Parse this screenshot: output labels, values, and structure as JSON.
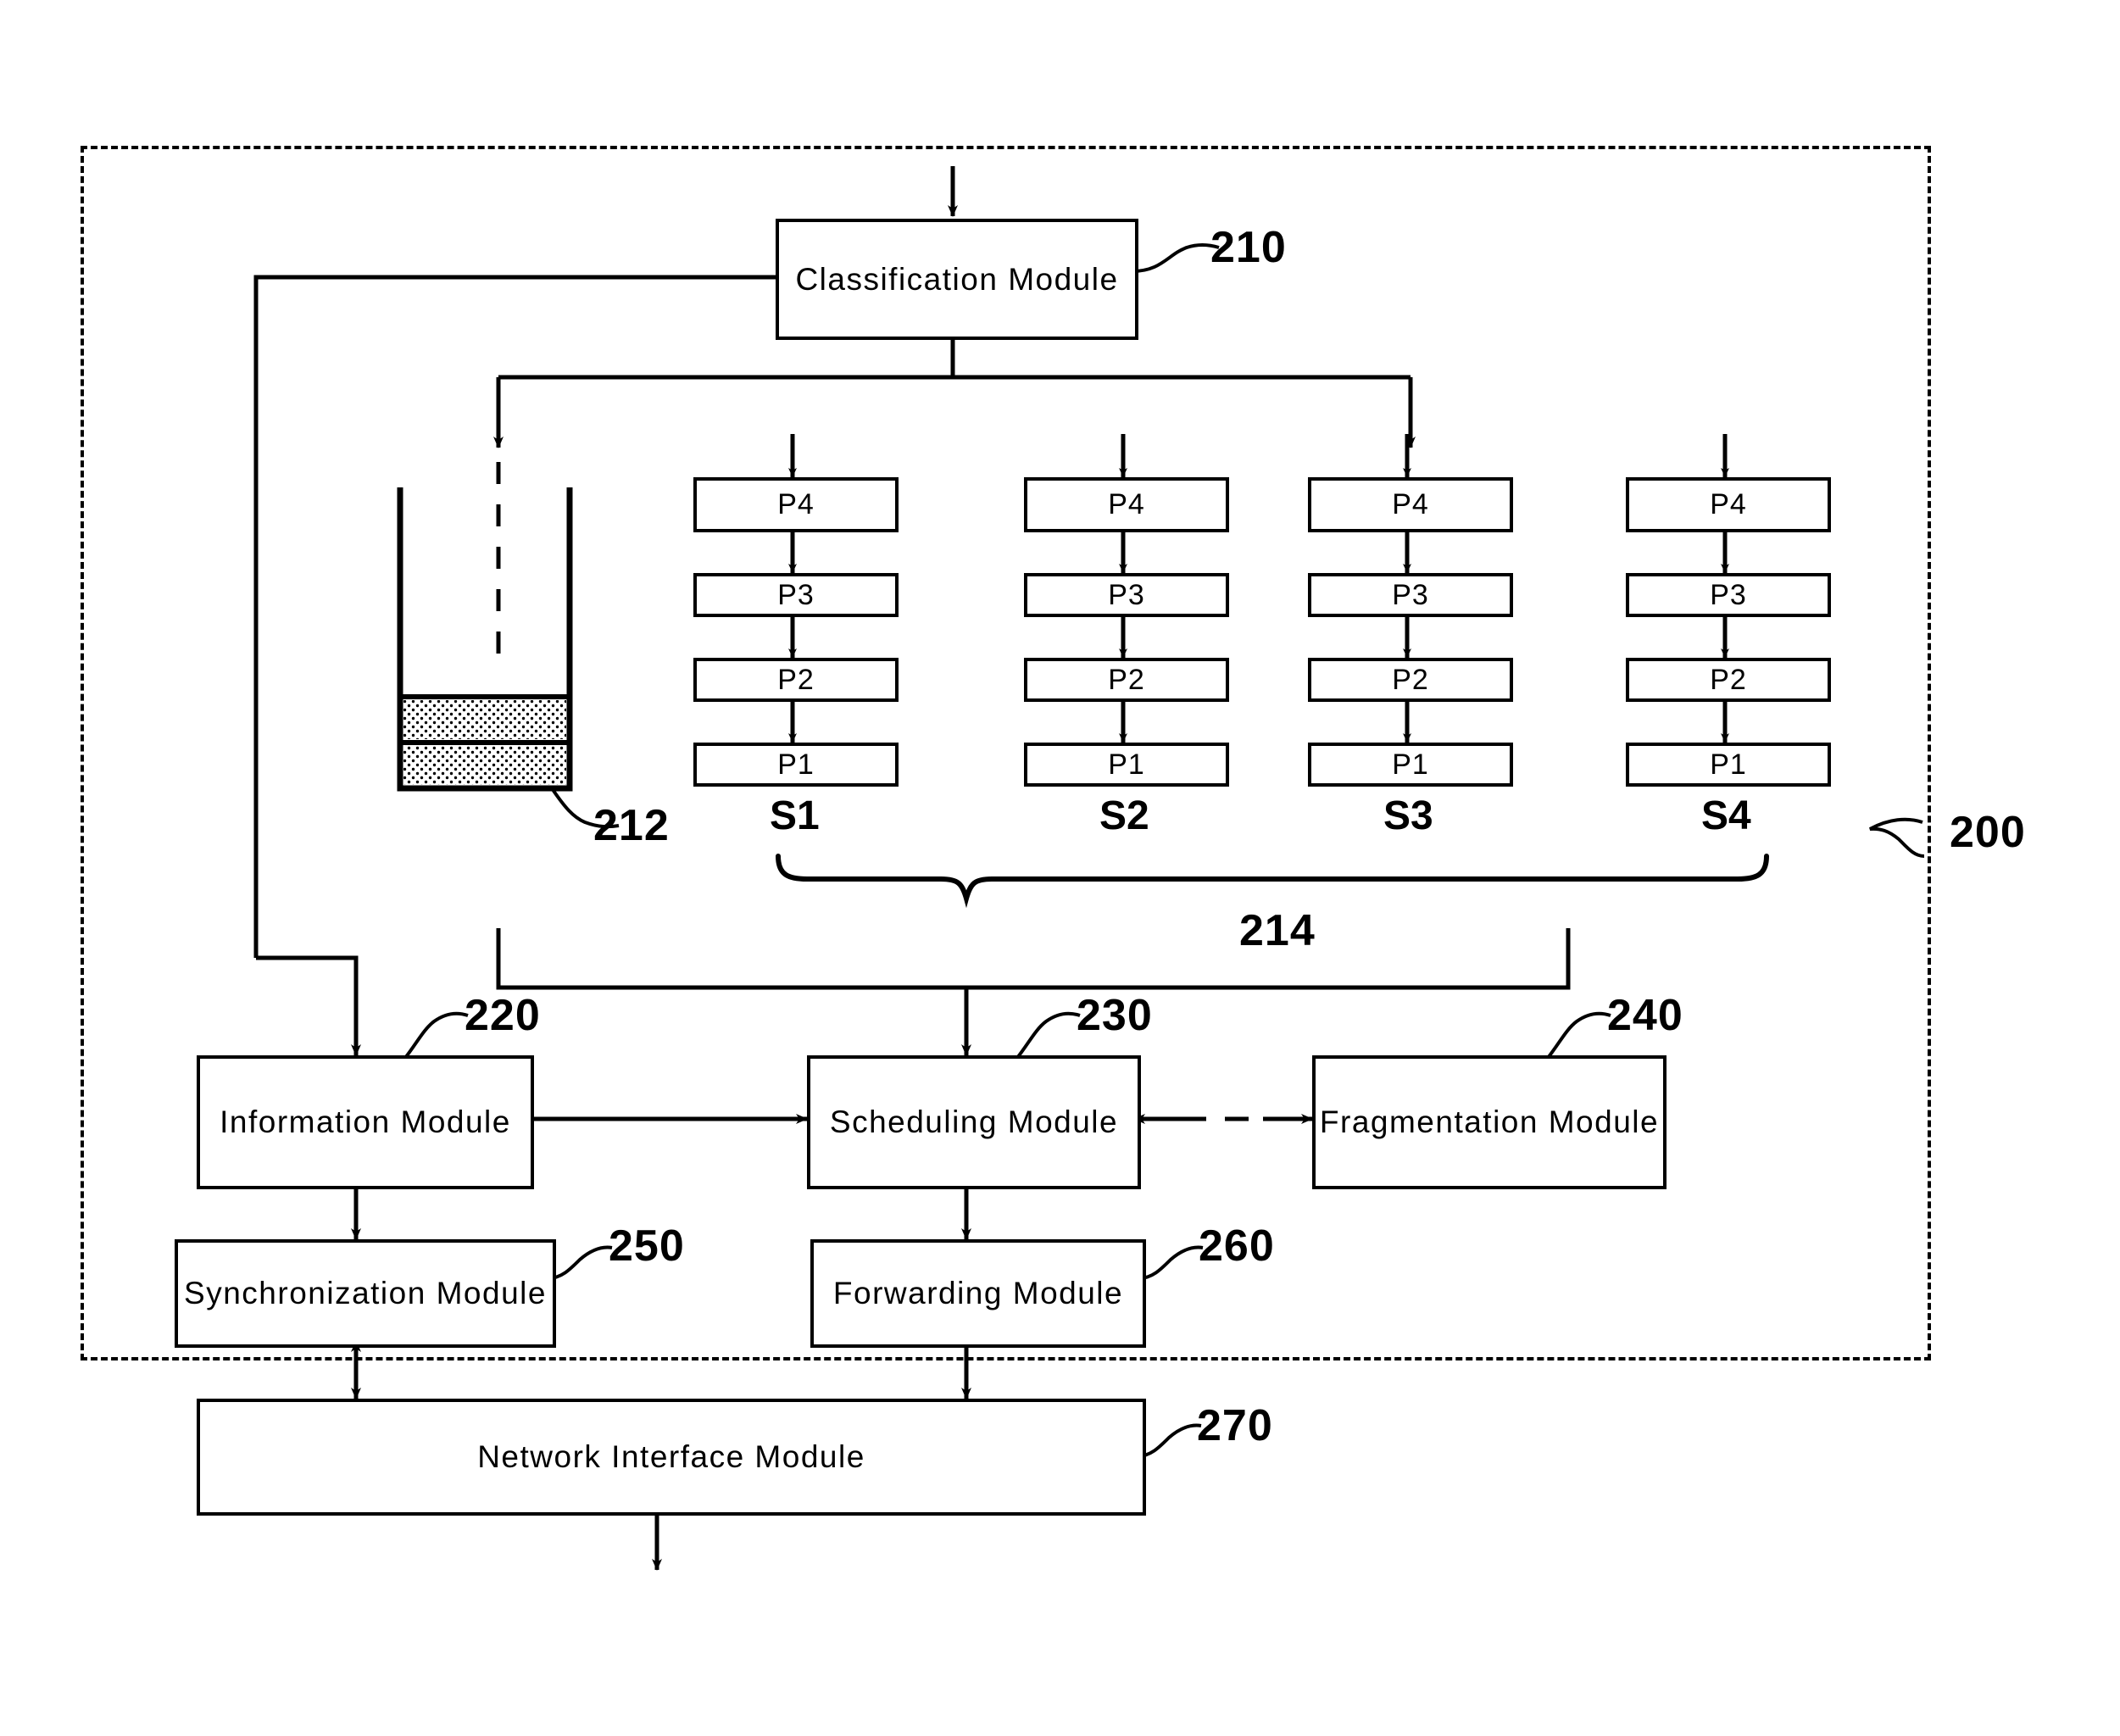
{
  "figure": {
    "type": "patent-block-diagram",
    "system_ref": "200",
    "outer_frame": "dashed-boundary"
  },
  "modules": [
    {
      "id": "classification",
      "label": "Classification  Module",
      "ref": "210"
    },
    {
      "id": "information",
      "label": "Information Module",
      "ref": "220"
    },
    {
      "id": "scheduling",
      "label": "Scheduling Module",
      "ref": "230"
    },
    {
      "id": "fragmentation",
      "label": "Fragmentation Module",
      "ref": "240"
    },
    {
      "id": "synchronization",
      "label": "Synchronization  Module",
      "ref": "250"
    },
    {
      "id": "forwarding",
      "label": "Forwarding Module",
      "ref": "260"
    },
    {
      "id": "network_interface",
      "label": "Network Interface Module",
      "ref": "270"
    }
  ],
  "buffer": {
    "ref": "212",
    "fill_bands": 2
  },
  "queues": {
    "ref": "214",
    "stack_labels": [
      "S1",
      "S2",
      "S3",
      "S4"
    ],
    "priority_labels": [
      "P4",
      "P3",
      "P2",
      "P1"
    ]
  },
  "refs": {
    "r200": "200",
    "r210": "210",
    "r212": "212",
    "r214": "214",
    "r220": "220",
    "r230": "230",
    "r240": "240",
    "r250": "250",
    "r260": "260",
    "r270": "270"
  },
  "colors": {
    "ink": "#000000",
    "paper": "#ffffff",
    "fill": "#cfcfcf"
  }
}
